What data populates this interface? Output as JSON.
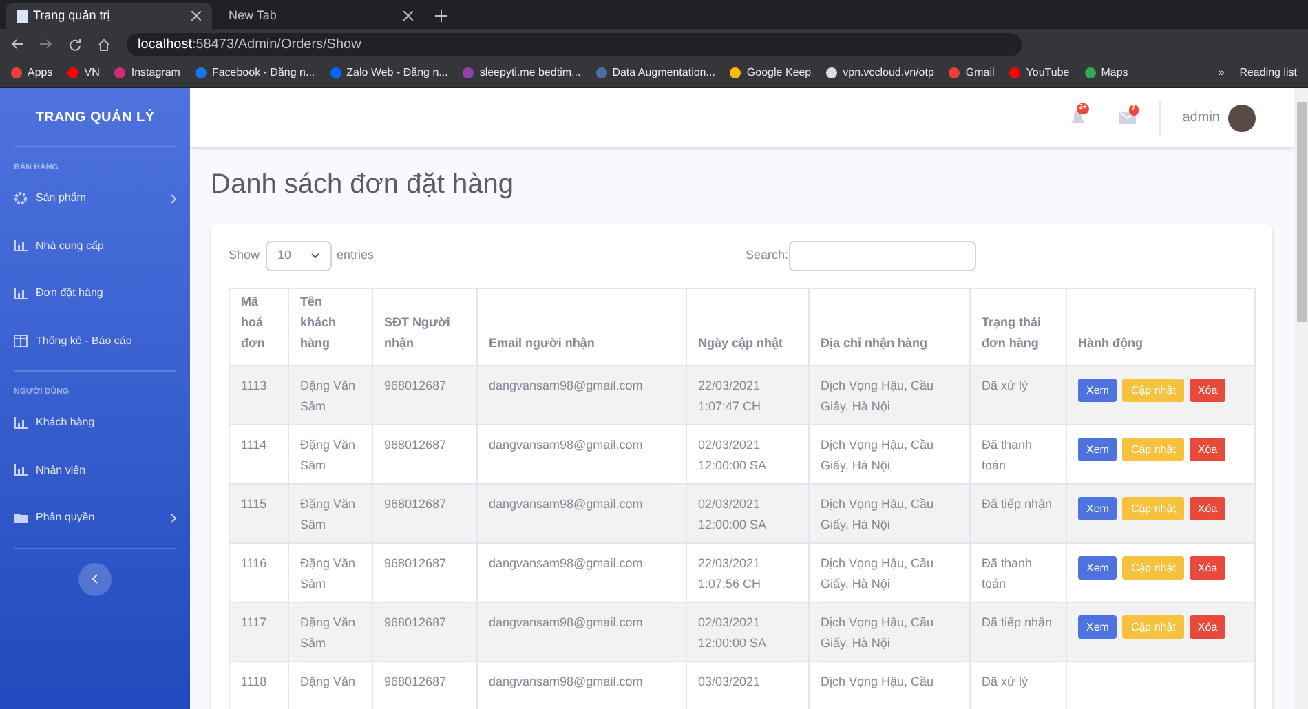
{
  "browser": {
    "tabs": [
      {
        "label": "Trang quản trị",
        "selected": true
      },
      {
        "label": "New Tab",
        "selected": false
      }
    ],
    "address": {
      "host": "localhost",
      "path": ":58473/Admin/Orders/Show"
    },
    "bookmarks": [
      {
        "label": "Apps",
        "color": "#e94235"
      },
      {
        "label": "VN",
        "color": "#ff0000"
      },
      {
        "label": "Instagram",
        "color": "#d62976"
      },
      {
        "label": "Facebook - Đăng n...",
        "color": "#1877f2"
      },
      {
        "label": "Zalo Web - Đăng n...",
        "color": "#0068ff"
      },
      {
        "label": "sleepyti.me bedtim...",
        "color": "#8e44ad"
      },
      {
        "label": "Data Augmentation...",
        "color": "#4a6fa5"
      },
      {
        "label": "Google Keep",
        "color": "#fbbc04"
      },
      {
        "label": "vpn.vccloud.vn/otp",
        "color": "#dddddd"
      },
      {
        "label": "Gmail",
        "color": "#ea4335"
      },
      {
        "label": "YouTube",
        "color": "#ff0000"
      },
      {
        "label": "Maps",
        "color": "#34a853"
      }
    ],
    "more": "»",
    "reading_list": "Reading list"
  },
  "sidebar": {
    "brand": "TRANG QUẢN LÝ",
    "sections": [
      {
        "heading": "BÁN HÀNG",
        "items": [
          {
            "label": "Sản phẩm",
            "kind": "gear",
            "submenu": true
          },
          {
            "label": "Nhà cung cấp",
            "kind": "chart",
            "submenu": false
          },
          {
            "label": "Đơn đặt hàng",
            "kind": "chart",
            "submenu": false
          },
          {
            "label": "Thống kê - Báo cáo",
            "kind": "table",
            "submenu": false
          }
        ]
      },
      {
        "heading": "NGƯỜI DÙNG",
        "items": [
          {
            "label": "Khách hàng",
            "kind": "chart",
            "submenu": false
          },
          {
            "label": "Nhân viên",
            "kind": "chart",
            "submenu": false
          },
          {
            "label": "Phân quyền",
            "kind": "folder",
            "submenu": true
          }
        ]
      }
    ]
  },
  "topbar": {
    "alerts_badge": "3+",
    "messages_badge": "7",
    "user": "admin"
  },
  "page_title": "Danh sách đơn đặt hàng",
  "table_controls": {
    "show": "Show",
    "page_size": "10",
    "entries": "entries",
    "search_label": "Search:"
  },
  "table": {
    "columns": [
      "Mã hoá đơn",
      "Tên khách hàng",
      "SĐT Người nhận",
      "Email người nhận",
      "Ngày cập nhật",
      "Địa chỉ nhận hàng",
      "Trạng thái đơn hàng",
      "Hành động"
    ],
    "rows": [
      {
        "cells": [
          "1113",
          "Đặng Văn Sâm",
          "968012687",
          "dangvansam98@gmail.com",
          "22/03/2021 1:07:47 CH",
          "Dịch Vọng Hậu, Cầu Giấy, Hà Nội",
          "Đã xử lý"
        ],
        "actions": [
          {
            "label": "Xem",
            "kind": "view"
          },
          {
            "label": "Cập nhật",
            "kind": "edit"
          },
          {
            "label": "Xóa",
            "kind": "delete"
          }
        ]
      },
      {
        "cells": [
          "1114",
          "Đặng Văn Sâm",
          "968012687",
          "dangvansam98@gmail.com",
          "02/03/2021 12:00:00 SA",
          "Dịch Vọng Hậu, Cầu Giấy, Hà Nội",
          "Đã thanh toán"
        ],
        "actions": [
          {
            "label": "Xem",
            "kind": "view"
          },
          {
            "label": "Cập nhật",
            "kind": "edit"
          },
          {
            "label": "Xóa",
            "kind": "delete"
          }
        ]
      },
      {
        "cells": [
          "1115",
          "Đặng Văn Sâm",
          "968012687",
          "dangvansam98@gmail.com",
          "02/03/2021 12:00:00 SA",
          "Dịch Vọng Hậu, Cầu Giấy, Hà Nội",
          "Đã tiếp nhận"
        ],
        "actions": [
          {
            "label": "Xem",
            "kind": "view"
          },
          {
            "label": "Cập nhật",
            "kind": "edit"
          },
          {
            "label": "Xóa",
            "kind": "delete"
          }
        ]
      },
      {
        "cells": [
          "1116",
          "Đặng Văn Sâm",
          "968012687",
          "dangvansam98@gmail.com",
          "22/03/2021 1:07:56 CH",
          "Dịch Vọng Hậu, Cầu Giấy, Hà Nội",
          "Đã thanh toán"
        ],
        "actions": [
          {
            "label": "Xem",
            "kind": "view"
          },
          {
            "label": "Cập nhật",
            "kind": "edit"
          },
          {
            "label": "Xóa",
            "kind": "delete"
          }
        ]
      },
      {
        "cells": [
          "1117",
          "Đặng Văn Sâm",
          "968012687",
          "dangvansam98@gmail.com",
          "02/03/2021 12:00:00 SA",
          "Dịch Vọng Hậu, Cầu Giấy, Hà Nội",
          "Đã tiếp nhận"
        ],
        "actions": [
          {
            "label": "Xem",
            "kind": "view"
          },
          {
            "label": "Cập nhật",
            "kind": "edit"
          },
          {
            "label": "Xóa",
            "kind": "delete"
          }
        ]
      },
      {
        "cells": [
          "1118",
          "Đặng Văn",
          "968012687",
          "dangvansam98@gmail.com",
          "03/03/2021",
          "Dịch Vọng Hậu, Cầu",
          "Đã xử lý"
        ],
        "actions": []
      }
    ]
  }
}
